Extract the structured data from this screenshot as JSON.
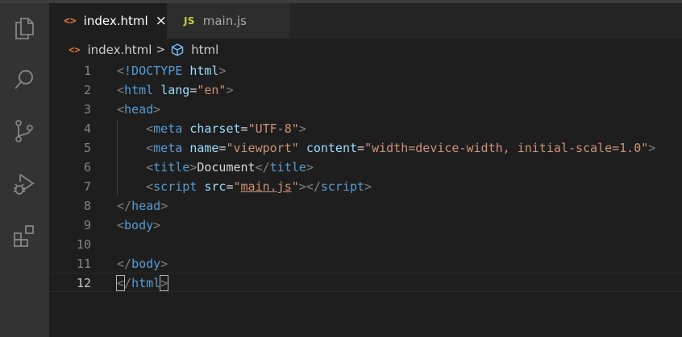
{
  "tabs": [
    {
      "icon": "html-file-icon",
      "glyph": "<>",
      "label": "index.html",
      "active": true,
      "close": "×"
    },
    {
      "icon": "js-file-icon",
      "glyph": "JS",
      "label": "main.js",
      "active": false
    }
  ],
  "breadcrumb": {
    "file_glyph": "<>",
    "file": "index.html",
    "separator": ">",
    "symbol_icon": "cube-icon",
    "symbol": "html"
  },
  "activity_bar": [
    {
      "name": "explorer-icon"
    },
    {
      "name": "search-icon"
    },
    {
      "name": "source-control-icon"
    },
    {
      "name": "run-debug-icon"
    },
    {
      "name": "extensions-icon"
    }
  ],
  "colors": {
    "tag": "#569cd6",
    "attribute": "#9cdcfe",
    "string": "#ce9178",
    "punctuation": "#808080",
    "text": "#d4d4d4",
    "html_icon": "#e37933",
    "js_icon": "#cbcb41"
  },
  "editor": {
    "current_line": 12,
    "lines": [
      {
        "num": "1",
        "tokens": [
          [
            "p",
            "<"
          ],
          [
            "t",
            "!DOCTYPE"
          ],
          [
            "x",
            " "
          ],
          [
            "a",
            "html"
          ],
          [
            "p",
            ">"
          ]
        ]
      },
      {
        "num": "2",
        "tokens": [
          [
            "p",
            "<"
          ],
          [
            "t",
            "html"
          ],
          [
            "x",
            " "
          ],
          [
            "a",
            "lang"
          ],
          [
            "x",
            "="
          ],
          [
            "s",
            "\"en\""
          ],
          [
            "p",
            ">"
          ]
        ]
      },
      {
        "num": "3",
        "tokens": [
          [
            "p",
            "<"
          ],
          [
            "t",
            "head"
          ],
          [
            "p",
            ">"
          ]
        ]
      },
      {
        "num": "4",
        "tokens": [
          [
            "x",
            "    "
          ],
          [
            "p",
            "<"
          ],
          [
            "t",
            "meta"
          ],
          [
            "x",
            " "
          ],
          [
            "a",
            "charset"
          ],
          [
            "x",
            "="
          ],
          [
            "s",
            "\"UTF-8\""
          ],
          [
            "p",
            ">"
          ]
        ]
      },
      {
        "num": "5",
        "tokens": [
          [
            "x",
            "    "
          ],
          [
            "p",
            "<"
          ],
          [
            "t",
            "meta"
          ],
          [
            "x",
            " "
          ],
          [
            "a",
            "name"
          ],
          [
            "x",
            "="
          ],
          [
            "s",
            "\"viewport\""
          ],
          [
            "x",
            " "
          ],
          [
            "a",
            "content"
          ],
          [
            "x",
            "="
          ],
          [
            "s",
            "\"width=device-width, initial-scale=1.0\""
          ],
          [
            "p",
            ">"
          ]
        ]
      },
      {
        "num": "6",
        "tokens": [
          [
            "x",
            "    "
          ],
          [
            "p",
            "<"
          ],
          [
            "t",
            "title"
          ],
          [
            "p",
            ">"
          ],
          [
            "x",
            "Document"
          ],
          [
            "p",
            "</"
          ],
          [
            "t",
            "title"
          ],
          [
            "p",
            ">"
          ]
        ]
      },
      {
        "num": "7",
        "tokens": [
          [
            "x",
            "    "
          ],
          [
            "p",
            "<"
          ],
          [
            "t",
            "script"
          ],
          [
            "x",
            " "
          ],
          [
            "a",
            "src"
          ],
          [
            "x",
            "="
          ],
          [
            "s",
            "\""
          ],
          [
            "u",
            "main.js"
          ],
          [
            "s",
            "\""
          ],
          [
            "p",
            "></"
          ],
          [
            "t",
            "script"
          ],
          [
            "p",
            ">"
          ]
        ]
      },
      {
        "num": "8",
        "tokens": [
          [
            "p",
            "</"
          ],
          [
            "t",
            "head"
          ],
          [
            "p",
            ">"
          ]
        ]
      },
      {
        "num": "9",
        "tokens": [
          [
            "p",
            "<"
          ],
          [
            "t",
            "body"
          ],
          [
            "p",
            ">"
          ]
        ]
      },
      {
        "num": "10",
        "tokens": []
      },
      {
        "num": "11",
        "tokens": [
          [
            "p",
            "</"
          ],
          [
            "t",
            "body"
          ],
          [
            "p",
            ">"
          ]
        ]
      },
      {
        "num": "12",
        "tokens": [
          [
            "b",
            "<"
          ],
          [
            "p",
            "/"
          ],
          [
            "t",
            "html"
          ],
          [
            "b",
            ">"
          ]
        ]
      }
    ]
  }
}
